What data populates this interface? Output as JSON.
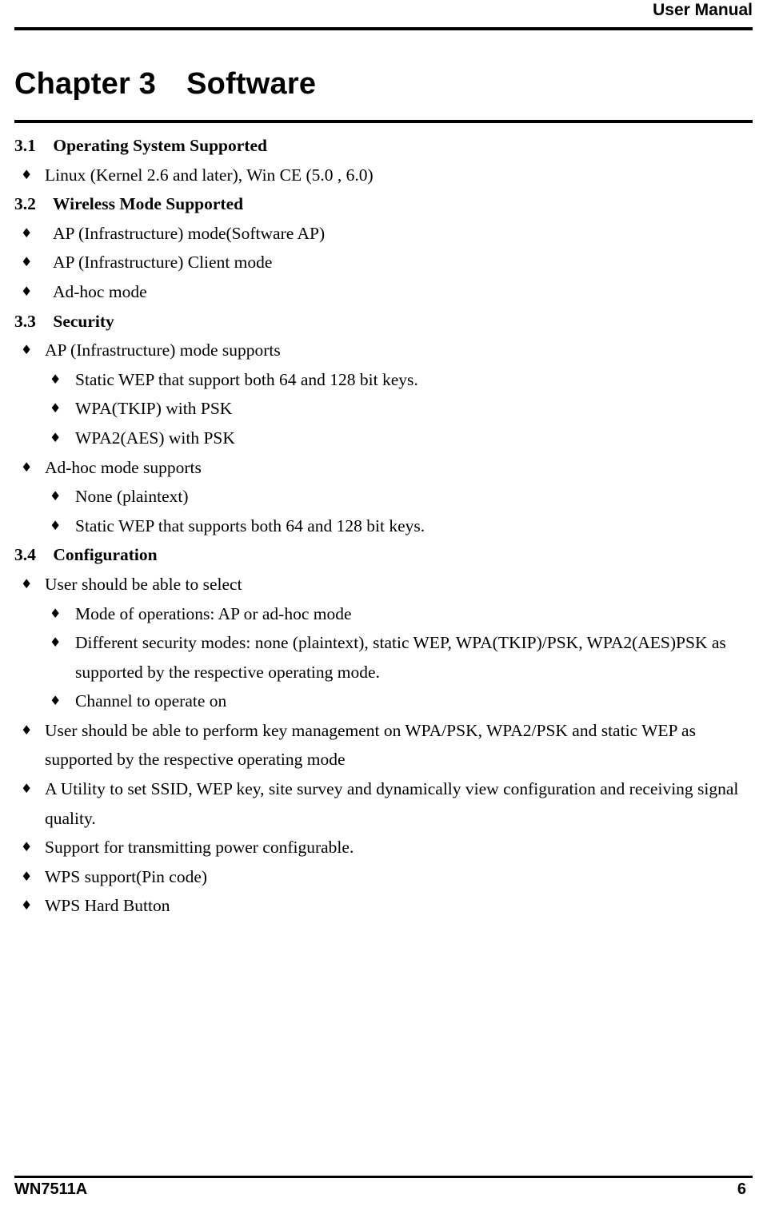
{
  "header": {
    "title": "User Manual"
  },
  "chapter": {
    "number": "Chapter 3",
    "name": "Software"
  },
  "sections": [
    {
      "heading": "3.1    Operating System Supported",
      "items": [
        {
          "level": 1,
          "text": "Linux (Kernel 2.6 and later), Win CE (5.0 , 6.0)"
        }
      ]
    },
    {
      "heading": "3.2    Wireless Mode Supported",
      "items": [
        {
          "level": 1,
          "text": "AP (Infrastructure) mode(Software AP)"
        },
        {
          "level": 1,
          "text": "AP (Infrastructure) Client mode"
        },
        {
          "level": 1,
          "text": "Ad-hoc mode"
        }
      ]
    },
    {
      "heading": "3.3    Security",
      "items": [
        {
          "level": 1,
          "text": "AP (Infrastructure) mode supports"
        },
        {
          "level": 2,
          "text": "Static WEP that support both 64 and 128 bit keys."
        },
        {
          "level": 2,
          "text": "WPA(TKIP) with PSK"
        },
        {
          "level": 2,
          "text": "WPA2(AES) with PSK"
        },
        {
          "level": 1,
          "text": "Ad-hoc mode supports"
        },
        {
          "level": 2,
          "text": "None (plaintext)"
        },
        {
          "level": 2,
          "text": "Static WEP that supports both 64 and 128 bit keys."
        }
      ]
    },
    {
      "heading": "3.4    Configuration",
      "items": [
        {
          "level": 1,
          "text": "User should be able to select"
        },
        {
          "level": 2,
          "text": "Mode of operations: AP or ad-hoc mode"
        },
        {
          "level": 2,
          "text": "Different security modes: none (plaintext), static WEP, WPA(TKIP)/PSK, WPA2(AES)PSK as supported by the respective operating mode."
        },
        {
          "level": 2,
          "text": "Channel to operate on"
        },
        {
          "level": 1,
          "text": "User should be able to perform key management on WPA/PSK, WPA2/PSK and static WEP as supported by the respective operating mode"
        },
        {
          "level": 1,
          "text": "A Utility to set SSID, WEP key, site survey and dynamically view configuration and receiving signal quality."
        },
        {
          "level": 1,
          "text": "Support for transmitting power configurable."
        },
        {
          "level": 1,
          "text": "WPS support(Pin code)"
        },
        {
          "level": 1,
          "text": "WPS Hard Button"
        }
      ]
    }
  ],
  "bullet_glyph": "♦",
  "footer": {
    "model": "WN7511A",
    "page_number": "6"
  }
}
